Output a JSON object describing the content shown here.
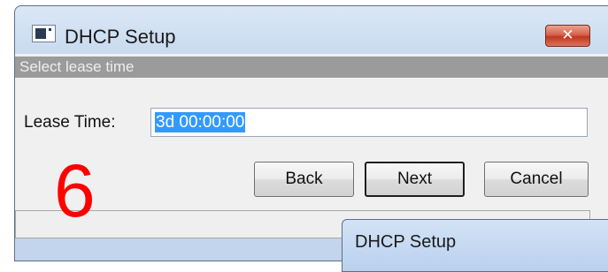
{
  "main_dialog": {
    "title": "DHCP Setup",
    "close_symbol": "✕",
    "section_header": "Select lease time",
    "lease_time": {
      "label": "Lease Time:",
      "value": "3d 00:00:00"
    },
    "buttons": {
      "back": "Back",
      "next": "Next",
      "cancel": "Cancel"
    },
    "step_number": "6",
    "status_text": ""
  },
  "second_dialog": {
    "title": "DHCP Setup"
  },
  "icons": {
    "app": "window-app-icon",
    "close": "close-icon"
  },
  "colors": {
    "selection": "#3399ff",
    "step_number": "#ff0000",
    "section_header": "#9b9b9b",
    "close_button": "#c1371f"
  }
}
